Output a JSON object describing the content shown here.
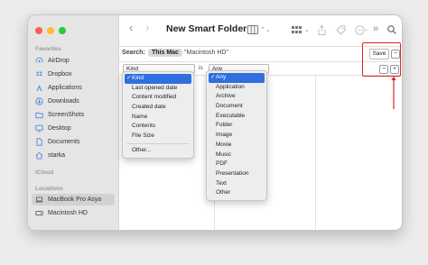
{
  "window": {
    "title": "New Smart Folder"
  },
  "sidebar": {
    "favorites_label": "Favorites",
    "favorites": [
      {
        "label": "AirDrop",
        "icon": "airdrop-icon"
      },
      {
        "label": "Dropbox",
        "icon": "dropbox-icon"
      },
      {
        "label": "Applications",
        "icon": "applications-icon"
      },
      {
        "label": "Downloads",
        "icon": "downloads-icon"
      },
      {
        "label": "ScreenShots",
        "icon": "folder-icon"
      },
      {
        "label": "Desktop",
        "icon": "desktop-icon"
      },
      {
        "label": "Documents",
        "icon": "documents-icon"
      },
      {
        "label": "starka",
        "icon": "home-icon"
      }
    ],
    "icloud_label": "iCloud",
    "locations_label": "Locations",
    "locations": [
      {
        "label": "MacBook Pro Asya",
        "icon": "laptop-icon"
      },
      {
        "label": "Macintosh HD",
        "icon": "disk-icon"
      }
    ]
  },
  "search": {
    "label": "Search:",
    "scope_active": "This Mac",
    "scope_other": "\"Macintosh HD\"",
    "save_label": "Save",
    "minus_label": "−"
  },
  "criteria": {
    "attribute_value": "Kind",
    "operator_label": "is",
    "kind_value": "Any",
    "minus_label": "−",
    "plus_label": "+"
  },
  "attribute_menu": {
    "items": [
      "Kind",
      "Last opened date",
      "Content modified",
      "Created date",
      "Name",
      "Contents",
      "File Size",
      "Other..."
    ],
    "selected": "Kind"
  },
  "kind_menu": {
    "items": [
      "Any",
      "Application",
      "Archive",
      "Document",
      "Executable",
      "Folder",
      "Image",
      "Movie",
      "Music",
      "PDF",
      "Presentation",
      "Text",
      "Other"
    ],
    "selected": "Any"
  },
  "colors": {
    "highlight": "#e02020",
    "accent": "#2f6fdf"
  }
}
